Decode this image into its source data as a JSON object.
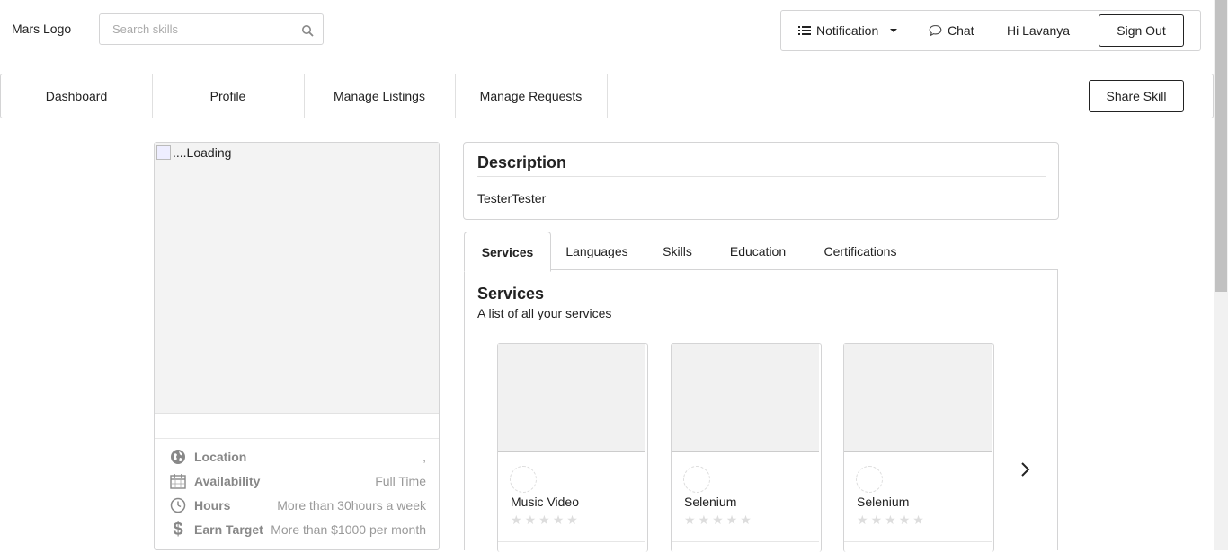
{
  "header": {
    "logo": "Mars Logo",
    "search_placeholder": "Search skills",
    "notification_label": "Notification",
    "chat_label": "Chat",
    "greeting": "Hi Lavanya",
    "sign_out_label": "Sign Out"
  },
  "nav": {
    "items": [
      {
        "label": "Dashboard"
      },
      {
        "label": "Profile"
      },
      {
        "label": "Manage Listings"
      },
      {
        "label": "Manage Requests"
      }
    ],
    "share_skill_label": "Share Skill"
  },
  "profile": {
    "image_alt": "....Loading",
    "rows": [
      {
        "label": "Location",
        "value": ",",
        "icon": "globe-icon"
      },
      {
        "label": "Availability",
        "value": "Full Time",
        "icon": "calendar-icon"
      },
      {
        "label": "Hours",
        "value": "More than 30hours a week",
        "icon": "clock-icon"
      },
      {
        "label": "Earn Target",
        "value": "More than $1000 per month",
        "icon": "dollar-icon"
      }
    ]
  },
  "description": {
    "title": "Description",
    "text": "TesterTester"
  },
  "tabs": [
    {
      "label": "Services",
      "active": true
    },
    {
      "label": "Languages",
      "active": false
    },
    {
      "label": "Skills",
      "active": false
    },
    {
      "label": "Education",
      "active": false
    },
    {
      "label": "Certifications",
      "active": false
    }
  ],
  "services": {
    "title": "Services",
    "subtitle": "A list of all your services",
    "cards": [
      {
        "name": "Music Video",
        "rating": 0
      },
      {
        "name": "Selenium",
        "rating": 0
      },
      {
        "name": "Selenium",
        "rating": 0
      }
    ]
  },
  "colors": {
    "border": "#d4d4d5",
    "placeholder_bg": "#f1f1f1",
    "star_empty": "#dddddd"
  }
}
